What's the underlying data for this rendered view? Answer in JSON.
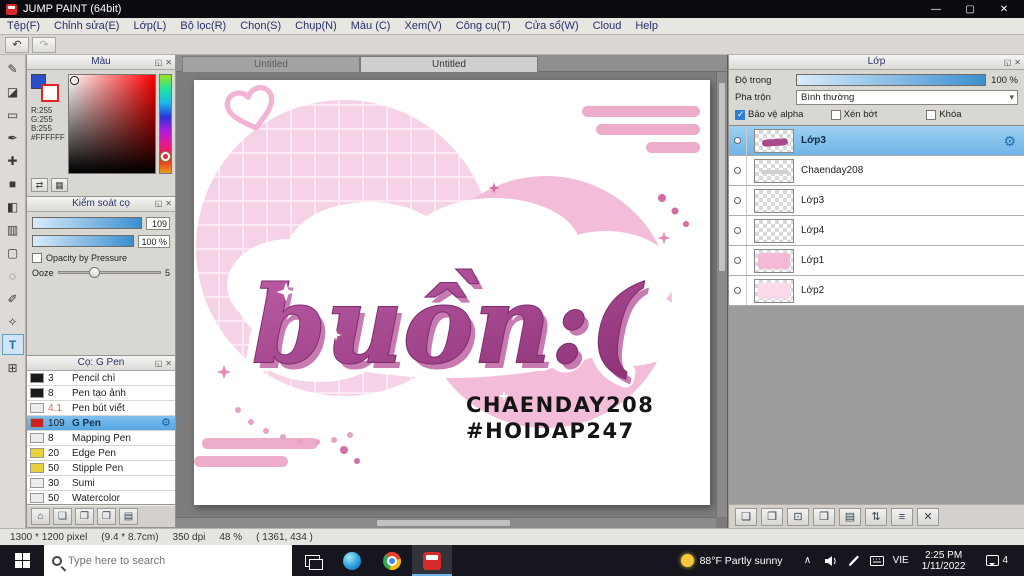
{
  "window": {
    "title": "JUMP PAINT (64bit)",
    "minimize": "—",
    "maximize": "▢",
    "close": "✕"
  },
  "panel_icons": {
    "popout": "◱",
    "close": "✕"
  },
  "menu": [
    "Tệp(F)",
    "Chỉnh sửa(E)",
    "Lớp(L)",
    "Bộ lọc(R)",
    "Chọn(S)",
    "Chụp(N)",
    "Màu (C)",
    "Xem(V)",
    "Công cụ(T)",
    "Cửa sổ(W)",
    "Cloud",
    "Help"
  ],
  "toolbar": {
    "undo": "↶",
    "redo": "↷"
  },
  "tools": [
    {
      "name": "pen-tool",
      "glyph": "✎"
    },
    {
      "name": "eraser-tool",
      "glyph": "◪"
    },
    {
      "name": "rect-tool",
      "glyph": "▭"
    },
    {
      "name": "ink-pen-tool",
      "glyph": "✒"
    },
    {
      "name": "move-tool",
      "glyph": "✚"
    },
    {
      "name": "shape-tool",
      "glyph": "■"
    },
    {
      "name": "fill-tool",
      "glyph": "◧"
    },
    {
      "name": "gradient-tool",
      "glyph": "▥"
    },
    {
      "name": "select-tool",
      "glyph": "▢"
    },
    {
      "name": "lasso-select-tool",
      "glyph": "◌"
    },
    {
      "name": "select-pen-tool",
      "glyph": "✐"
    },
    {
      "name": "magic-wand-tool",
      "glyph": "✧"
    },
    {
      "name": "text-tool",
      "glyph": "T",
      "active": true
    },
    {
      "name": "zoom-grid-tool",
      "glyph": "⊞"
    }
  ],
  "color_panel": {
    "title": "Màu",
    "r": "R:255",
    "g": "G:255",
    "b": "B:255",
    "hex": "#FFFFFF",
    "footer_buttons": [
      {
        "name": "color-swap-button",
        "glyph": "⇄"
      },
      {
        "name": "color-palette-button",
        "glyph": "▦"
      }
    ]
  },
  "brush_control": {
    "title": "Kiểm soát cọ",
    "size_value": "109",
    "opacity_value": "100 %",
    "pressure_label": "Opacity by Pressure",
    "ooze_label": "Ooze",
    "ooze_value": "5"
  },
  "brush_panel": {
    "title": "Cọ: G Pen",
    "brushes": [
      {
        "size": "3",
        "name": "Pencil chì",
        "swatch": "#1b1b1b"
      },
      {
        "size": "8",
        "name": "Pen tạo ảnh",
        "swatch": "#1b1b1b"
      },
      {
        "size": "4.1",
        "name": "Pen bút viết",
        "swatch": "#ededed",
        "size_color": "#e2645a"
      },
      {
        "size": "109",
        "name": "G Pen",
        "swatch": "#cf2020",
        "selected": true
      },
      {
        "size": "8",
        "name": "Mapping Pen",
        "swatch": "#ededed"
      },
      {
        "size": "20",
        "name": "Edge Pen",
        "swatch": "#e7d23e"
      },
      {
        "size": "50",
        "name": "Stipple Pen",
        "swatch": "#e7d23e"
      },
      {
        "size": "30",
        "name": "Sumi",
        "swatch": "#ededed"
      },
      {
        "size": "50",
        "name": "Watercolor",
        "swatch": "#ededed"
      }
    ],
    "footer_buttons": [
      {
        "name": "brush-home-button",
        "glyph": "⌂"
      },
      {
        "name": "brush-new-button",
        "glyph": "❏"
      },
      {
        "name": "brush-duplicate-button",
        "glyph": "❐"
      },
      {
        "name": "brush-import-button",
        "glyph": "❒"
      },
      {
        "name": "brush-folder-button",
        "glyph": "▤"
      }
    ]
  },
  "canvas": {
    "tabs": [
      {
        "label": "Untitled"
      },
      {
        "label": "Untitled",
        "active": true
      }
    ],
    "artwork": {
      "word": "buồn:(",
      "credit1": "CHAENDAY208",
      "credit2": "#HOIDAP247"
    }
  },
  "layers_panel": {
    "title": "Lớp",
    "opacity_label": "Độ trong",
    "opacity_value": "100 %",
    "blend_label": "Pha trộn",
    "blend_value": "Bình thường",
    "options": [
      {
        "label": "Bảo vệ alpha",
        "checked": true
      },
      {
        "label": "Xén bớt",
        "checked": false
      },
      {
        "label": "Khóa",
        "checked": false
      }
    ],
    "gear_icon": "⚙",
    "layers": [
      {
        "name": "Lớp3",
        "thumb": "art",
        "selected": true
      },
      {
        "name": "Chaenday208",
        "thumb": "dark"
      },
      {
        "name": "Lớp3",
        "thumb": "checker"
      },
      {
        "name": "Lớp4",
        "thumb": "checker"
      },
      {
        "name": "Lớp1",
        "thumb": "pink"
      },
      {
        "name": "Lớp2",
        "thumb": "pinklight"
      }
    ],
    "footer_buttons": [
      {
        "name": "layer-new-button",
        "glyph": "❏"
      },
      {
        "name": "layer-duplicate-button",
        "glyph": "❐"
      },
      {
        "name": "layer-camera-button",
        "glyph": "⊡"
      },
      {
        "name": "layer-add-folder-button",
        "glyph": "❒"
      },
      {
        "name": "layer-folder-button",
        "glyph": "▤"
      },
      {
        "name": "layer-transfer-button",
        "glyph": "⇅"
      },
      {
        "name": "layer-merge-button",
        "glyph": "≡"
      },
      {
        "name": "layer-delete-button",
        "glyph": "✕"
      }
    ]
  },
  "status_bar": {
    "dimensions": "1300 * 1200 pixel",
    "size_cm": "(9.4 * 8.7cm)",
    "dpi": "350 dpi",
    "zoom": "48 %",
    "coords": "( 1361, 434 )"
  },
  "taskbar": {
    "search_placeholder": "Type here to search",
    "weather": "88°F Partly sunny",
    "tray_chevron": "∧",
    "language": "VIE",
    "time": "2:25 PM",
    "date": "1/11/2022",
    "badge": "4"
  }
}
